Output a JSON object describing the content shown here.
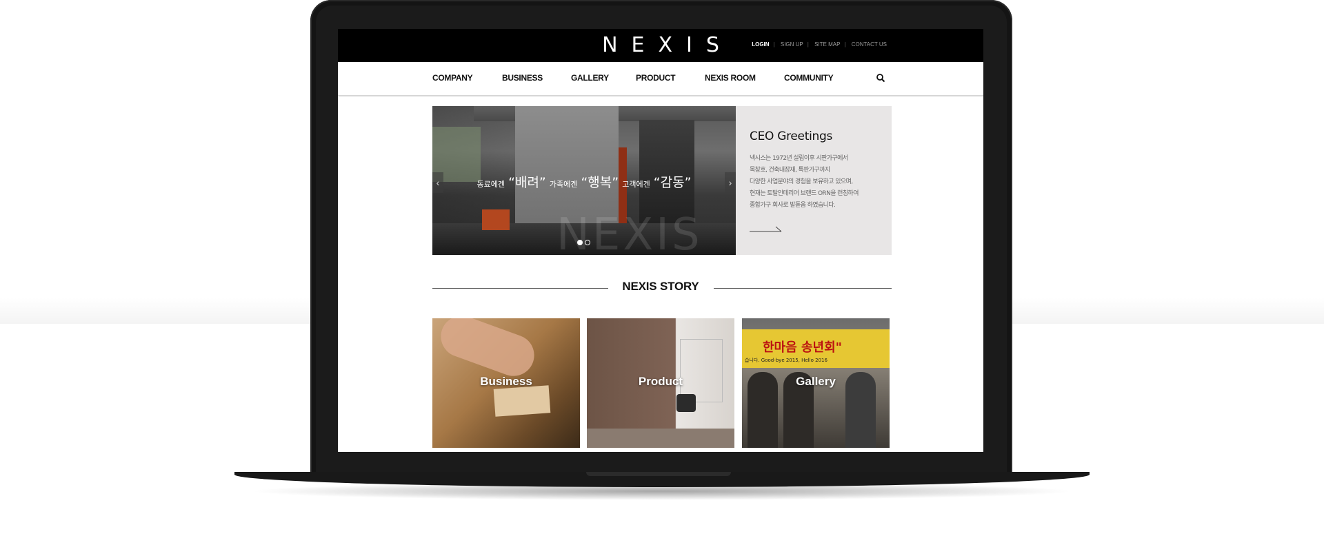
{
  "site": {
    "logo": "NEXIS",
    "utility_links": [
      "LOGIN",
      "SIGN UP",
      "SITE MAP",
      "CONTACT US"
    ],
    "nav": [
      "COMPANY",
      "BUSINESS",
      "GALLERY",
      "PRODUCT",
      "NEXIS ROOM",
      "COMMUNITY"
    ],
    "search_icon": "search-icon"
  },
  "hero": {
    "caption_parts": [
      "동료에겐",
      "“배려”",
      "가족에겐",
      "“행복”",
      "고객에겐",
      "“감동”"
    ],
    "watermark": "NEXIS",
    "slides_total": 2,
    "active_slide": 1
  },
  "ceo": {
    "title": "CEO Greetings",
    "lines": [
      "넥시스는 1972년 설립이후 시판가구에서",
      "목창호, 건축내장재, 특판가구까지",
      "다양한 사업분야의 경험을 보유하고 있으며,",
      "현재는 토탈인테리어 브랜드 ORN을 런칭하여",
      "종합가구 회사로 발돋움 하였습니다."
    ]
  },
  "story": {
    "title": "NEXIS STORY",
    "cards": [
      "Business",
      "Product",
      "Gallery"
    ]
  },
  "gallery_photo_text": {
    "banner": "한마음 송년회\"",
    "sub": "습니다. Good-bye 2015, Hello 2016"
  }
}
